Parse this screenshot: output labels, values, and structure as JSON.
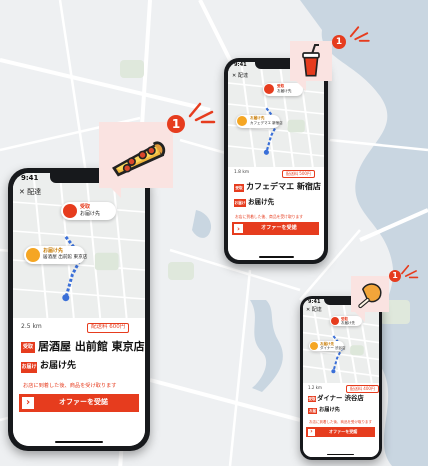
{
  "colors": {
    "accent": "#e63c1e",
    "callout_bg": "#fae3e1",
    "water": "#c9d6e1",
    "map": "#eceeed",
    "route": "#3a6fd8"
  },
  "phones": [
    {
      "status_time": "9:41",
      "close_label": "✕ 配達",
      "pickup_pin": "受取",
      "pickup_name": "居酒屋 出前館 東京店",
      "dropoff_pin": "お届け先",
      "dropoff_name": "お届け先",
      "distance_text": "2.5 km",
      "fee_text": "配送料 600円",
      "shop_tag": "受取",
      "shop_name": "居酒屋 出前館 東京店",
      "dest_tag": "お届け",
      "dest_name": "お届け先",
      "warning_text": "お店に到着した後、商品を受け取ります",
      "cta_label": "オファーを受諾",
      "cta_arrow": "›",
      "notification_count": "1",
      "icon": "pizza-icon"
    },
    {
      "status_time": "9:41",
      "close_label": "✕ 配達",
      "pickup_pin": "受取",
      "pickup_name": "カフェデマエ 新宿店",
      "dropoff_pin": "お届け先",
      "dropoff_name": "お届け先",
      "distance_text": "1.8 km",
      "fee_text": "配送料 500円",
      "shop_tag": "受取",
      "shop_name": "カフェデマエ 新宿店",
      "dest_tag": "お届け",
      "dest_name": "お届け先",
      "warning_text": "お店に到着した後、商品を受け取ります",
      "cta_label": "オファーを受諾",
      "cta_arrow": "›",
      "notification_count": "1",
      "icon": "drink-cup-icon"
    },
    {
      "status_time": "9:41",
      "close_label": "✕ 配達",
      "pickup_pin": "受取",
      "pickup_name": "ダイナー 渋谷店",
      "dropoff_pin": "お届け先",
      "dropoff_name": "お届け先",
      "distance_text": "1.2 km",
      "fee_text": "配送料 400円",
      "shop_tag": "受取",
      "shop_name": "ダイナー 渋谷店",
      "dest_tag": "お届け",
      "dest_name": "お届け先",
      "warning_text": "お店に到着した後、商品を受け取ります",
      "cta_label": "オファーを受諾",
      "cta_arrow": "›",
      "notification_count": "1",
      "icon": "chicken-leg-icon"
    }
  ]
}
